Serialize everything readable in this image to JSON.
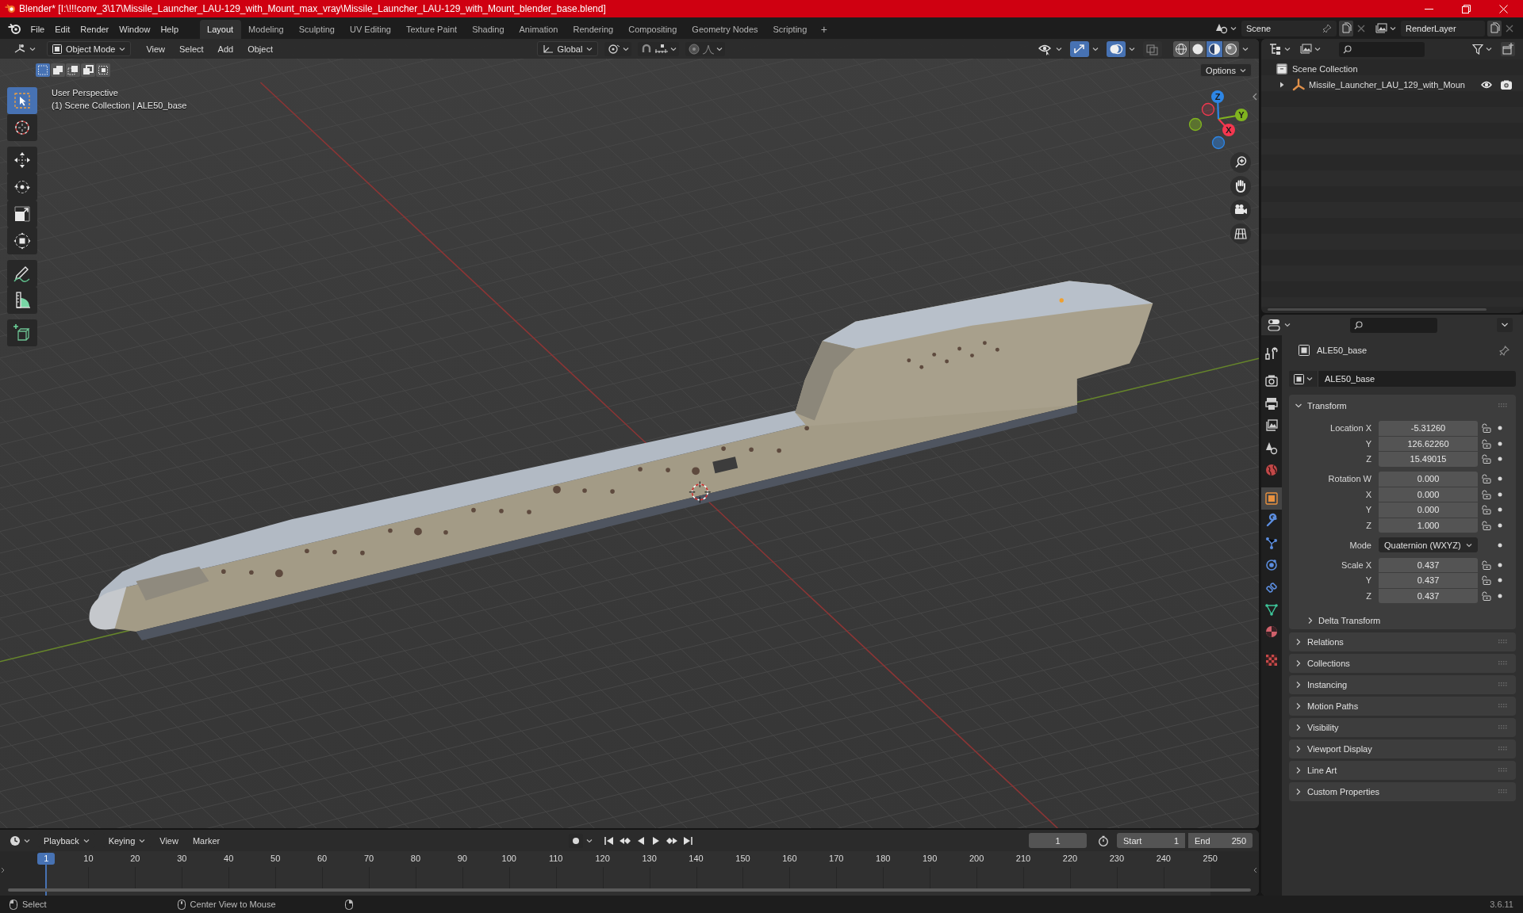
{
  "window": {
    "title": "Blender* [I:\\!!!conv_3\\17\\Missile_Launcher_LAU-129_with_Mount_max_vray\\Missile_Launcher_LAU-129_with_Mount_blender_base.blend]"
  },
  "top_bar": {
    "menu": [
      "File",
      "Edit",
      "Render",
      "Window",
      "Help"
    ],
    "workspaces": [
      {
        "label": "Layout",
        "selected": true
      },
      {
        "label": "Modeling",
        "selected": false
      },
      {
        "label": "Sculpting",
        "selected": false
      },
      {
        "label": "UV Editing",
        "selected": false
      },
      {
        "label": "Texture Paint",
        "selected": false
      },
      {
        "label": "Shading",
        "selected": false
      },
      {
        "label": "Animation",
        "selected": false
      },
      {
        "label": "Rendering",
        "selected": false
      },
      {
        "label": "Compositing",
        "selected": false
      },
      {
        "label": "Geometry Nodes",
        "selected": false
      },
      {
        "label": "Scripting",
        "selected": false
      }
    ],
    "add_workspace": "+",
    "scene": "Scene",
    "view_layer": "RenderLayer"
  },
  "viewport": {
    "mode": "Object Mode",
    "menus": [
      "View",
      "Select",
      "Add",
      "Object"
    ],
    "orientation": "Global",
    "select_modes": [
      {
        "kind": "set",
        "selected": true
      },
      {
        "kind": "extend",
        "selected": false
      },
      {
        "kind": "subtract",
        "selected": false
      },
      {
        "kind": "invert",
        "selected": false
      },
      {
        "kind": "intersect",
        "selected": false
      }
    ],
    "toggles": [
      {
        "kind": "gizmos",
        "on": true
      },
      {
        "kind": "overlays",
        "on": true
      },
      {
        "kind": "xray",
        "on": false
      }
    ],
    "shading": [
      {
        "kind": "wireframe",
        "selected": false
      },
      {
        "kind": "solid",
        "selected": false
      },
      {
        "kind": "material",
        "selected": true
      },
      {
        "kind": "rendered",
        "selected": false
      }
    ],
    "options": "Options",
    "info": [
      "User Perspective",
      "(1) Scene Collection | ALE50_base"
    ],
    "tool_groups": [
      [
        {
          "kind": "select_box",
          "selected": true
        },
        {
          "kind": "cursor",
          "selected": false
        }
      ],
      [
        {
          "kind": "move",
          "selected": false
        },
        {
          "kind": "rotate",
          "selected": false
        },
        {
          "kind": "scale",
          "selected": false
        },
        {
          "kind": "transform",
          "selected": false
        }
      ],
      [
        {
          "kind": "annotate",
          "selected": false
        },
        {
          "kind": "measure",
          "selected": false
        }
      ],
      [
        {
          "kind": "add_cube",
          "selected": false
        }
      ]
    ],
    "gizmo_axes": [
      {
        "label": "X",
        "color": "#f5374f"
      },
      {
        "label": "Y",
        "color": "#80b41f"
      },
      {
        "label": "Z",
        "color": "#2d86e6"
      }
    ]
  },
  "outliner": {
    "tree": [
      {
        "label": "Scene Collection",
        "kind": "scene_collection",
        "children": [
          {
            "label": "Missile_Launcher_LAU_129_with_Moun",
            "kind": "empty",
            "expanded": false,
            "visible": true,
            "renderable": true
          }
        ]
      }
    ]
  },
  "properties": {
    "tab_groups": [
      [
        {
          "kind": "tool",
          "selected": false
        }
      ],
      [
        {
          "kind": "render",
          "selected": false
        },
        {
          "kind": "output",
          "selected": false
        },
        {
          "kind": "view_layer",
          "selected": false
        },
        {
          "kind": "scene",
          "selected": false
        },
        {
          "kind": "world",
          "selected": false
        }
      ],
      [
        {
          "kind": "object",
          "selected": true
        },
        {
          "kind": "modifiers",
          "selected": false
        },
        {
          "kind": "particles",
          "selected": false
        },
        {
          "kind": "physics",
          "selected": false
        },
        {
          "kind": "constraints",
          "selected": false
        },
        {
          "kind": "data",
          "selected": false
        },
        {
          "kind": "material",
          "selected": false
        }
      ],
      [
        {
          "kind": "texture",
          "selected": false
        }
      ]
    ],
    "object": "ALE50_base",
    "name": "ALE50_base",
    "panels": [
      {
        "label": "Transform",
        "expanded": true,
        "groups": [
          {
            "kind": "fields",
            "rows": [
              {
                "label": "Location X",
                "value": "-5.31260",
                "locked": false
              },
              {
                "label": "Y",
                "value": "126.62260",
                "locked": false
              },
              {
                "label": "Z",
                "value": "15.49015",
                "locked": false
              }
            ]
          },
          {
            "kind": "fields",
            "rows": [
              {
                "label": "Rotation W",
                "value": "0.000",
                "locked": false
              },
              {
                "label": "X",
                "value": "0.000",
                "locked": false
              },
              {
                "label": "Y",
                "value": "0.000",
                "locked": false
              },
              {
                "label": "Z",
                "value": "1.000",
                "locked": false
              }
            ]
          },
          {
            "kind": "dropdown",
            "label": "Mode",
            "value": "Quaternion (WXYZ)"
          },
          {
            "kind": "fields",
            "rows": [
              {
                "label": "Scale X",
                "value": "0.437",
                "locked": false
              },
              {
                "label": "Y",
                "value": "0.437",
                "locked": false
              },
              {
                "label": "Z",
                "value": "0.437",
                "locked": false
              }
            ]
          }
        ],
        "subpanels": [
          {
            "label": "Delta Transform",
            "expanded": false
          }
        ]
      },
      {
        "label": "Relations",
        "expanded": false
      },
      {
        "label": "Collections",
        "expanded": false
      },
      {
        "label": "Instancing",
        "expanded": false
      },
      {
        "label": "Motion Paths",
        "expanded": false
      },
      {
        "label": "Visibility",
        "expanded": false
      },
      {
        "label": "Viewport Display",
        "expanded": false
      },
      {
        "label": "Line Art",
        "expanded": false
      },
      {
        "label": "Custom Properties",
        "expanded": false
      }
    ]
  },
  "timeline": {
    "menus": [
      "Playback",
      "Keying",
      "View",
      "Marker"
    ],
    "auto_keying": false,
    "current_frame": "1",
    "start": {
      "label": "Start",
      "value": "1"
    },
    "end": {
      "label": "End",
      "value": "250"
    },
    "playhead": "1",
    "ruler": [
      "10",
      "20",
      "30",
      "40",
      "50",
      "60",
      "70",
      "80",
      "90",
      "100",
      "110",
      "120",
      "130",
      "140",
      "150",
      "160",
      "170",
      "180",
      "190",
      "200",
      "210",
      "220",
      "230",
      "240",
      "250"
    ]
  },
  "status_bar": {
    "hints": [
      {
        "kind": "mouse_left",
        "label": "Select"
      },
      {
        "kind": "mouse_middle",
        "label": "Center View to Mouse"
      },
      {
        "kind": "mouse_right"
      }
    ],
    "version": "3.6.11"
  }
}
